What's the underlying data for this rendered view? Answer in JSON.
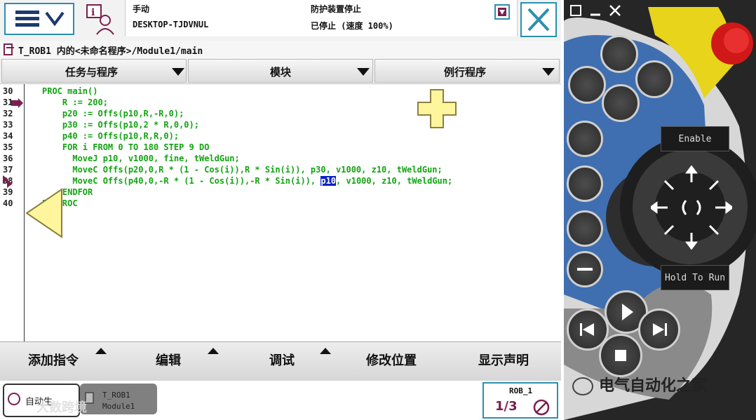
{
  "header": {
    "mode": "手动",
    "controller": "DESKTOP-TJDVNUL",
    "safety_state": "防护装置停止",
    "run_state": "已停止 (速度 100%)"
  },
  "path": "T_ROB1 内的<未命名程序>/Module1/main",
  "tabs": [
    {
      "label": "任务与程序"
    },
    {
      "label": "模块"
    },
    {
      "label": "例行程序"
    }
  ],
  "code": {
    "line_numbers": [
      "30",
      "31",
      "32",
      "33",
      "34",
      "35",
      "36",
      "37",
      "38",
      "39",
      "40"
    ],
    "lines": [
      "PROC main()",
      "    R := 200;",
      "    p20 := Offs(p10,R,-R,0);",
      "    p30 := Offs(p10,2 * R,0,0);",
      "    p40 := Offs(p10,R,R,0);",
      "    FOR i FROM 0 TO 180 STEP 9 DO",
      "      MoveJ p10, v1000, fine, tWeldGun;",
      "      MoveC Offs(p20,0,R * (1 - Cos(i)),R * Sin(i)), p30, v1000, z10, tWeldGun;",
      "      MoveC Offs(p40,0,-R * (1 - Cos(i)),-R * Sin(i)), ",
      "    ENDFOR",
      "ENDPROC"
    ],
    "line38_highlight": "p10",
    "line38_rest": ", v1000, z10, tWeldGun;"
  },
  "commands": [
    {
      "label": "添加指令"
    },
    {
      "label": "编辑"
    },
    {
      "label": "调试"
    },
    {
      "label": "修改位置"
    },
    {
      "label": "显示声明"
    }
  ],
  "taskbar": {
    "auto_label": "自动生",
    "task_name": "T_ROB1",
    "task_module": "Module1",
    "robot": "ROB_1",
    "fraction": "1/3"
  },
  "pendant": {
    "enable_label": "Enable",
    "hold_label": "Hold To Run"
  },
  "watermark": "电气自动化之家",
  "overlay_text": "大数跨境",
  "colors": {
    "code": "#14a314",
    "accent": "#2c8fae",
    "highlight": "#0a22c8"
  }
}
